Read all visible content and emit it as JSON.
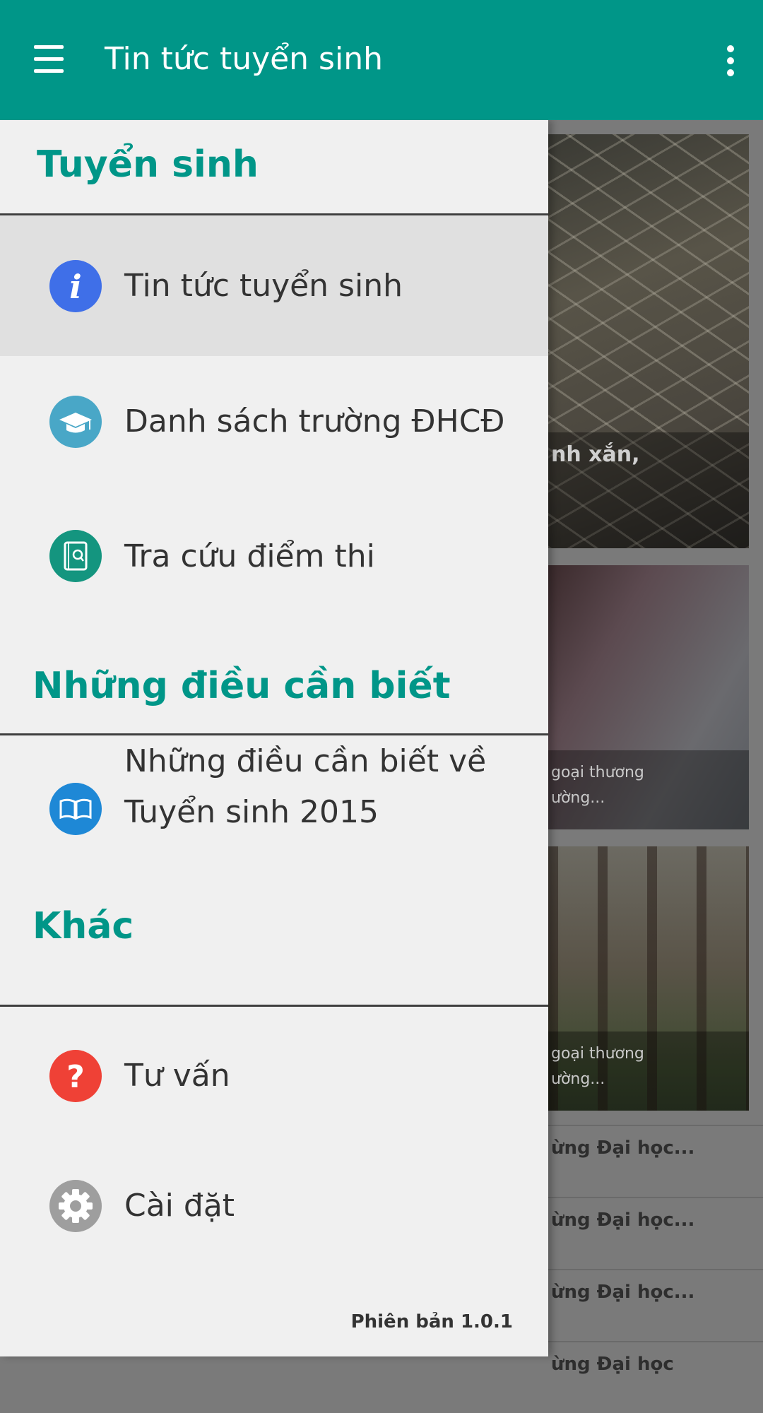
{
  "appbar": {
    "title": "Tin tức tuyển sinh",
    "color": "#009688"
  },
  "drawer": {
    "sections": [
      {
        "title": "Tuyển sinh",
        "items": [
          {
            "label": "Tin tức tuyển sinh",
            "icon": "info-icon",
            "selected": true
          },
          {
            "label": "Danh sách trường ĐHCĐ",
            "icon": "graduation-cap-icon"
          },
          {
            "label": "Tra cứu điểm thi",
            "icon": "book-search-icon"
          }
        ]
      },
      {
        "title": "Những điều cần biết",
        "items": [
          {
            "label_line1": "Những điều cần biết về",
            "label_line2": "Tuyển sinh 2015",
            "icon": "open-book-icon"
          }
        ]
      },
      {
        "title": "Khác",
        "items": [
          {
            "label": "Tư vấn",
            "icon": "question-icon"
          },
          {
            "label": "Cài đặt",
            "icon": "gear-icon"
          }
        ]
      }
    ],
    "version": "Phiên bản 1.0.1"
  },
  "feed": {
    "cards": [
      {
        "caption": "nh xắn,"
      },
      {
        "caption_line1": "goại thương",
        "caption_line2": "ường..."
      },
      {
        "caption_line1": "goại thương",
        "caption_line2": "ường..."
      }
    ],
    "list_items": [
      "ừng Đại học...",
      "ừng Đại học...",
      "ừng Đại học...",
      "ừng Đại học"
    ]
  },
  "colors": {
    "accent": "#009688",
    "info_icon": "#3f6fe8",
    "cap_icon": "#49a7c7",
    "book_search_icon": "#14957f",
    "open_book_icon": "#1e88d6",
    "question_icon": "#ef4136",
    "gear_icon": "#9e9e9e"
  }
}
